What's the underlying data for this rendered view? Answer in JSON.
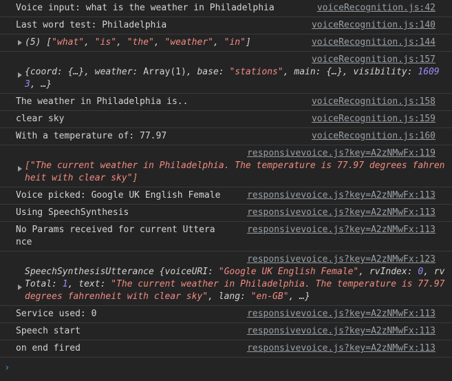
{
  "rows": [
    {
      "text": "Voice input: what is the weather in Philadelphia",
      "source": "voiceRecognition.js:42"
    },
    {
      "text": "Last word test: Philadelphia",
      "source": "voiceRecognition.js:140"
    },
    {
      "source": "voiceRecognition.js:144",
      "array_prefix": "(5) [",
      "items": [
        "\"what\"",
        "\"is\"",
        "\"the\"",
        "\"weather\"",
        "\"in\""
      ],
      "array_suffix": "]"
    },
    {
      "source": "voiceRecognition.js:157",
      "obj_a": "{coord: {…}, weather: ",
      "obj_b": "Array(1)",
      "obj_c": ", base: ",
      "obj_base": "\"stations\"",
      "obj_d": ", main: {…}, visibility: ",
      "obj_vis": "16093",
      "obj_e": ", …}"
    },
    {
      "text": "The weather in Philadelphia is..",
      "source": "voiceRecognition.js:158"
    },
    {
      "text": "clear sky",
      "source": "voiceRecognition.js:159"
    },
    {
      "text": "With a temperature of: 77.97",
      "source": "voiceRecognition.js:160"
    },
    {
      "source": "responsivevoice.js?key=A2zNMwFx:119",
      "text": "[\"The current weather in Philadelphia. The temperature is 77.97 degrees fahrenheit with clear sky\"]"
    },
    {
      "text": "Voice picked: Google UK English Female",
      "source": "responsivevoice.js?key=A2zNMwFx:113"
    },
    {
      "text": "Using SpeechSynthesis",
      "source": "responsivevoice.js?key=A2zNMwFx:113"
    },
    {
      "text": "No Params received for current Utterance",
      "source": "responsivevoice.js?key=A2zNMwFx:113"
    },
    {
      "source": "responsivevoice.js?key=A2zNMwFx:123",
      "p1": "SpeechSynthesisUtterance {voiceURI: ",
      "v1": "\"Google UK English Female\"",
      "p2": ", rvIndex: ",
      "v2": "0",
      "p3": ", rvTotal: ",
      "v3": "1",
      "p4": ", text: ",
      "v4": "\"The current weather in Philadelphia. The temperature is 77.97 degrees fahrenheit with clear sky\"",
      "p5": ", lang: ",
      "v5": "\"en-GB\"",
      "p6": ", …}"
    },
    {
      "text": "Service used: 0",
      "source": "responsivevoice.js?key=A2zNMwFx:113"
    },
    {
      "text": "Speech start",
      "source": "responsivevoice.js?key=A2zNMwFx:113"
    },
    {
      "text": "on end fired",
      "source": "responsivevoice.js?key=A2zNMwFx:113"
    }
  ],
  "prompt_symbol": "›"
}
